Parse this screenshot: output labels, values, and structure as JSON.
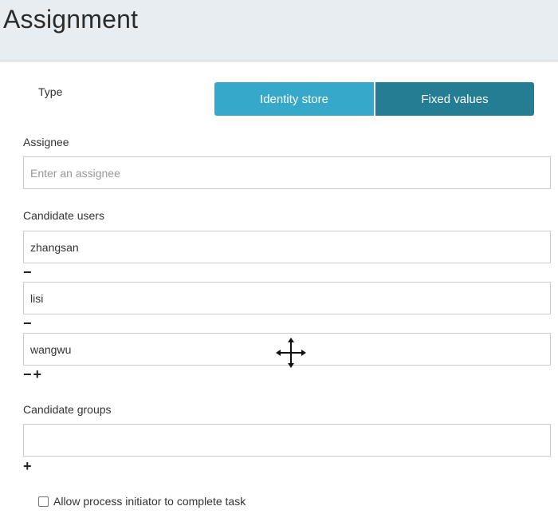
{
  "header": {
    "title": "Assignment"
  },
  "type": {
    "label": "Type",
    "options": [
      {
        "label": "Identity store",
        "color": "#36a9cb"
      },
      {
        "label": "Fixed values",
        "color": "#257d94",
        "selected": true
      }
    ]
  },
  "assignee": {
    "label": "Assignee",
    "placeholder": "Enter an assignee",
    "value": ""
  },
  "candidate_users": {
    "label": "Candidate users",
    "items": [
      {
        "value": "zhangsan"
      },
      {
        "value": "lisi"
      },
      {
        "value": "wangwu"
      }
    ],
    "remove_symbol": "−",
    "add_symbol": "+"
  },
  "candidate_groups": {
    "label": "Candidate groups",
    "items": [
      {
        "value": ""
      }
    ],
    "add_symbol": "+"
  },
  "initiator": {
    "label": "Allow process initiator to complete task",
    "checked": false
  },
  "cursor": {
    "icon": "move-cursor-icon"
  }
}
